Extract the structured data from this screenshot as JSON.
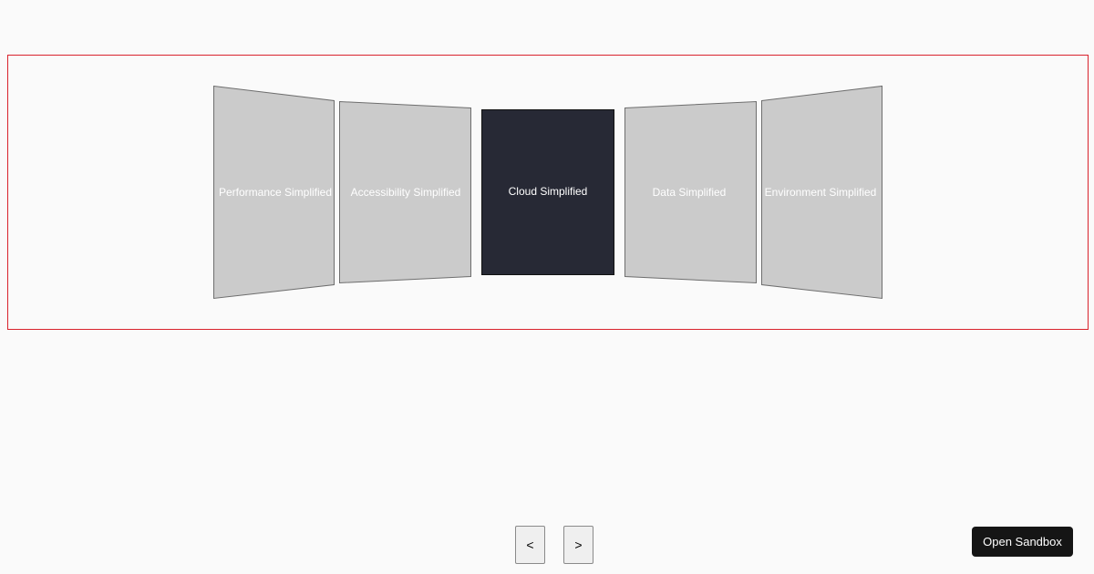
{
  "carousel": {
    "active_index": 2,
    "cards": [
      {
        "label": "Performance Simplified"
      },
      {
        "label": "Accessibility Simplified"
      },
      {
        "label": "Cloud Simplified"
      },
      {
        "label": "Data Simplified"
      },
      {
        "label": "Environment Simplified"
      }
    ]
  },
  "controls": {
    "prev_label": "<",
    "next_label": ">"
  },
  "sandbox": {
    "label": "Open Sandbox"
  },
  "colors": {
    "frame_border": "#d9232d",
    "card_inactive": "#cbcbcb",
    "card_active": "#272935",
    "card_text": "#ffffff"
  }
}
